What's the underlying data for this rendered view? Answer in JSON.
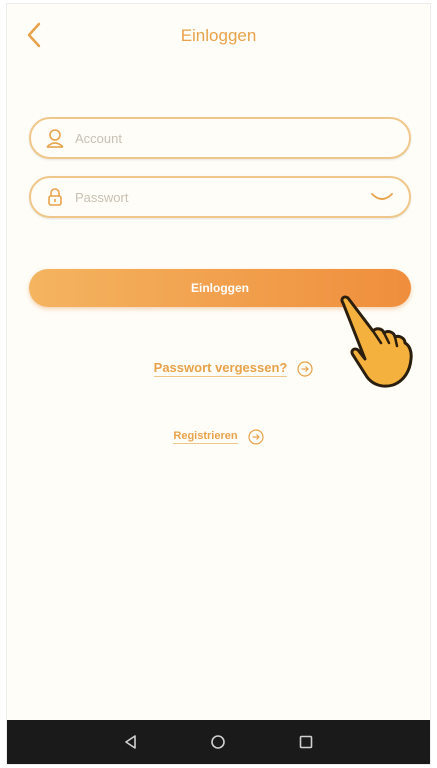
{
  "header": {
    "title": "Einloggen",
    "back_icon": "chevron-left-icon"
  },
  "form": {
    "account": {
      "placeholder": "Account",
      "value": "",
      "icon": "user-icon"
    },
    "password": {
      "placeholder": "Passwort",
      "value": "",
      "icon": "lock-icon",
      "toggle_icon": "eye-closed-icon"
    },
    "login_label": "Einloggen"
  },
  "links": {
    "forgot_label": "Passwort vergessen?",
    "register_label": "Registrieren",
    "arrow_icon": "circle-arrow-right-icon"
  },
  "overlay": {
    "icon": "hand-pointer-icon"
  },
  "nav_bar": {
    "back_icon": "triangle-back-icon",
    "home_icon": "circle-home-icon",
    "recents_icon": "square-recents-icon"
  },
  "colors": {
    "accent": "#e8a24a",
    "button_start": "#f4b460",
    "button_end": "#ef8e3c",
    "field_border": "#f0c78a",
    "background": "#fffdf7",
    "nav_bar": "#1a1a1a"
  }
}
